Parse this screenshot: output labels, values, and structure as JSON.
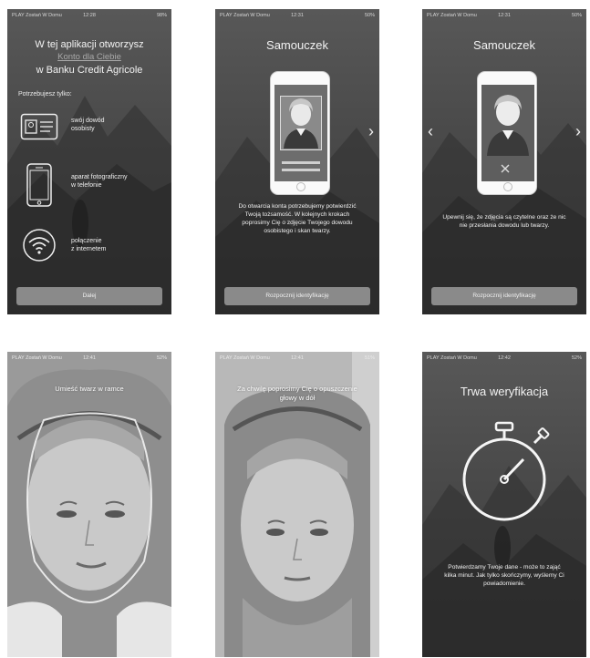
{
  "status_bars": [
    {
      "carrier": "PLAY Zostań W Domu",
      "time": "12:28",
      "battery": "98%"
    },
    {
      "carrier": "PLAY Zostań W Domu",
      "time": "12:31",
      "battery": "50%"
    },
    {
      "carrier": "PLAY Zostań W Domu",
      "time": "12:31",
      "battery": "50%"
    },
    {
      "carrier": "PLAY Zostań W Domu",
      "time": "12:41",
      "battery": "52%"
    },
    {
      "carrier": "PLAY Zostań W Domu",
      "time": "12:41",
      "battery": "51%"
    },
    {
      "carrier": "PLAY Zostań W Domu",
      "time": "12:42",
      "battery": "52%"
    }
  ],
  "screen1": {
    "title_line1": "W tej aplikacji otworzysz",
    "title_link": "Konto dla Ciebie",
    "title_line3": "w Banku Credit Agricole",
    "need_label": "Potrzebujesz tylko:",
    "items": [
      {
        "icon": "id-card-icon",
        "line1": "swój dowód",
        "line2": "osobisty"
      },
      {
        "icon": "smartphone-icon",
        "line1": "aparat fotograficzny",
        "line2": "w telefonie"
      },
      {
        "icon": "wifi-icon",
        "line1": "połączenie",
        "line2": "z internetem"
      }
    ],
    "button": "Dalej"
  },
  "screen2": {
    "title": "Samouczek",
    "text": "Do otwarcia konta potrzebujemy potwierdzić Twoją tożsamość. W kolejnych krokach poprosimy Cię o zdjęcie Twojego dowodu osobistego i skan twarzy.",
    "button": "Rozpocznij identyfikację",
    "active_dot": 1,
    "dots": 4
  },
  "screen3": {
    "title": "Samouczek",
    "text": "Upewnij się, że zdjęcia są czytelne oraz że nic nie przesłania dowodu lub twarzy.",
    "button": "Rozpocznij identyfikację",
    "active_dot": 3,
    "dots": 4
  },
  "screen4": {
    "caption": "Umieść twarz w ramce"
  },
  "screen5": {
    "caption": "Za chwilę poprosimy Cię o opuszczenie głowy w dół"
  },
  "screen6": {
    "title": "Trwa weryfikacja",
    "text": "Potwierdzamy Twoje dane - może to zająć kilka minut. Jak tylko skończymy, wyślemy Ci powiadomienie."
  }
}
